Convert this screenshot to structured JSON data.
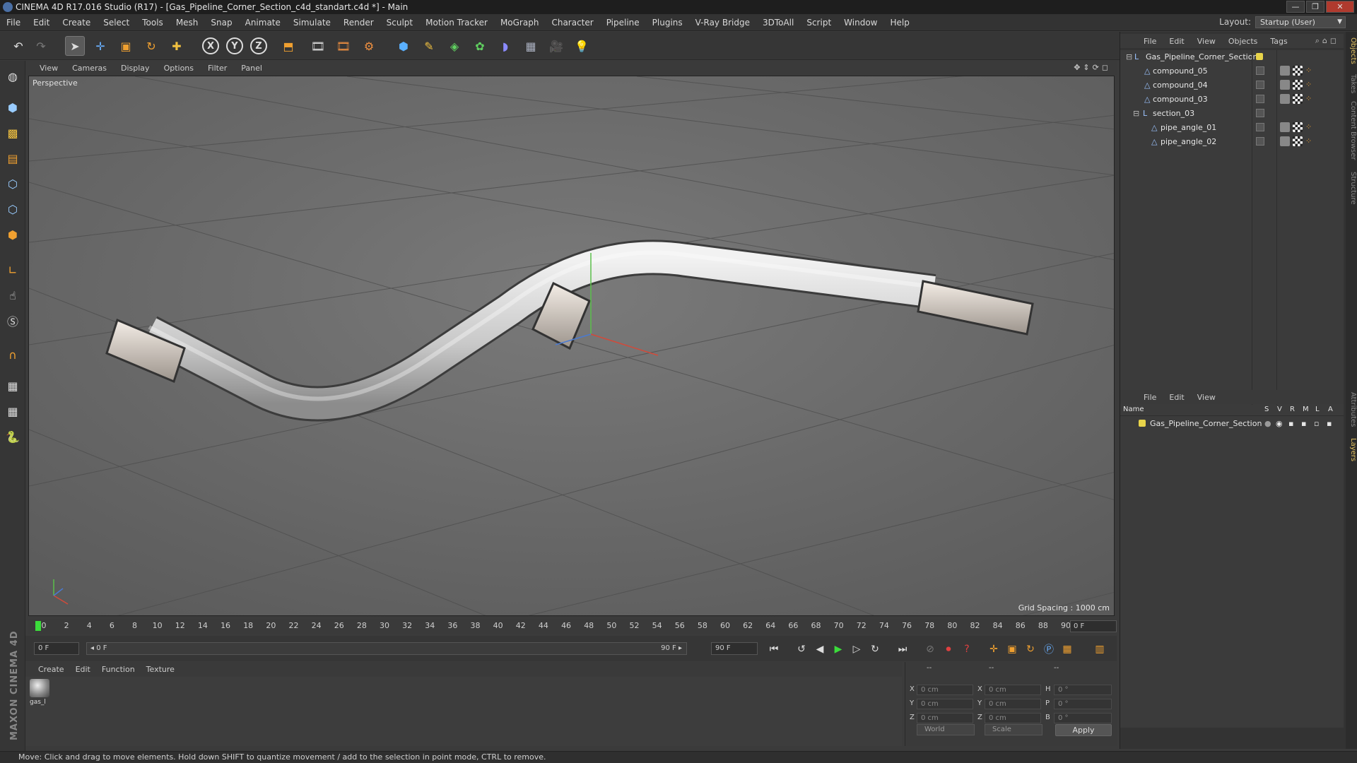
{
  "window": {
    "title": "CINEMA 4D R17.016 Studio (R17) - [Gas_Pipeline_Corner_Section_c4d_standart.c4d *] - Main",
    "buttons": [
      "—",
      "❐",
      "✕"
    ]
  },
  "menubar": {
    "items": [
      "File",
      "Edit",
      "Create",
      "Select",
      "Tools",
      "Mesh",
      "Snap",
      "Animate",
      "Simulate",
      "Render",
      "Sculpt",
      "Motion Tracker",
      "MoGraph",
      "Character",
      "Pipeline",
      "Plugins",
      "V-Ray Bridge",
      "3DToAll",
      "Script",
      "Window",
      "Help"
    ],
    "layout_label": "Layout:",
    "layout_value": "Startup (User)"
  },
  "toolbar": {
    "icons": [
      "undo-icon",
      "redo-icon",
      "select-arrow-icon",
      "move-icon",
      "scale-icon",
      "rotate-icon",
      "live-selection-icon",
      "x-axis-icon",
      "y-axis-icon",
      "z-axis-icon",
      "coordinate-system-icon",
      "render-view-icon",
      "render-picture-viewer-icon",
      "edit-render-settings-icon",
      "cube-icon",
      "pen-icon",
      "subdivision-icon",
      "cloner-icon",
      "deformer-icon",
      "floor-icon",
      "camera-icon",
      "light-icon"
    ],
    "axis_labels": [
      "X",
      "Y",
      "Z"
    ]
  },
  "left_tools": [
    "make-editable-icon",
    "model-mode-icon",
    "texture-mode-icon",
    "workplane-icon",
    "points-mode-icon",
    "edges-mode-icon",
    "polygons-mode-icon",
    "axis-mode-icon",
    "tweak-icon",
    "snap-s-icon",
    "magnet-icon",
    "grid-snap-icon",
    "grid-lock-icon",
    "python-icon"
  ],
  "viewport": {
    "menu": [
      "View",
      "Cameras",
      "Display",
      "Options",
      "Filter",
      "Panel"
    ],
    "label": "Perspective",
    "grid_spacing": "Grid Spacing : 1000 cm",
    "nav_icons": [
      "move-view-icon",
      "zoom-view-icon",
      "rotate-view-icon",
      "maximize-view-icon"
    ]
  },
  "timeline": {
    "ticks": [
      "0",
      "2",
      "4",
      "6",
      "8",
      "10",
      "12",
      "14",
      "16",
      "18",
      "20",
      "22",
      "24",
      "26",
      "28",
      "30",
      "32",
      "34",
      "36",
      "38",
      "40",
      "42",
      "44",
      "46",
      "48",
      "50",
      "52",
      "54",
      "56",
      "58",
      "60",
      "62",
      "64",
      "66",
      "68",
      "70",
      "72",
      "74",
      "76",
      "78",
      "80",
      "82",
      "84",
      "86",
      "88",
      "90"
    ],
    "current_frame": "0 F",
    "start_frame": "0 F",
    "range_start": "◂ 0 F",
    "range_end": "90 F ▸",
    "end_frame": "90 F"
  },
  "transport": {
    "icons": [
      "go-start-icon",
      "prev-key-icon",
      "play-back-icon",
      "play-icon",
      "next-frame-icon",
      "next-key-icon",
      "go-end-icon",
      "record-icon",
      "autokey-icon",
      "key-help-icon",
      "move-key-icon",
      "scale-key-icon",
      "rotate-key-icon",
      "param-key-icon",
      "pla-key-icon",
      "timeline-icon"
    ]
  },
  "material_manager": {
    "menu": [
      "Create",
      "Edit",
      "Function",
      "Texture"
    ],
    "material_name": "gas_l"
  },
  "coordinates": {
    "header": [
      "--",
      "--",
      "--"
    ],
    "rows": [
      {
        "axis": "X",
        "pos": "0 cm",
        "axis2": "X",
        "size": "0 cm",
        "rot_label": "H",
        "rot": "0 °"
      },
      {
        "axis": "Y",
        "pos": "0 cm",
        "axis2": "Y",
        "size": "0 cm",
        "rot_label": "P",
        "rot": "0 °"
      },
      {
        "axis": "Z",
        "pos": "0 cm",
        "axis2": "Z",
        "size": "0 cm",
        "rot_label": "B",
        "rot": "0 °"
      }
    ],
    "space": "World",
    "mode": "Scale",
    "apply": "Apply"
  },
  "status": "Move: Click and drag to move elements. Hold down SHIFT to quantize movement / add to the selection in point mode, CTRL to remove.",
  "object_manager": {
    "menu": [
      "File",
      "Edit",
      "View",
      "Objects",
      "Tags"
    ],
    "objects": [
      {
        "name": "Gas_Pipeline_Corner_Section",
        "depth": 0,
        "type": "null"
      },
      {
        "name": "compound_05",
        "depth": 1,
        "type": "mesh"
      },
      {
        "name": "compound_04",
        "depth": 1,
        "type": "mesh"
      },
      {
        "name": "compound_03",
        "depth": 1,
        "type": "mesh"
      },
      {
        "name": "section_03",
        "depth": 1,
        "type": "null"
      },
      {
        "name": "pipe_angle_01",
        "depth": 2,
        "type": "mesh"
      },
      {
        "name": "pipe_angle_02",
        "depth": 2,
        "type": "mesh"
      }
    ]
  },
  "layer_manager": {
    "menu": [
      "File",
      "Edit",
      "View"
    ],
    "columns": [
      "Name",
      "S",
      "V",
      "R",
      "M",
      "L",
      "A"
    ],
    "layers": [
      {
        "name": "Gas_Pipeline_Corner_Section",
        "color": "#e8d44a"
      }
    ]
  },
  "side_tabs": [
    "Objects",
    "Takes",
    "Content Browser",
    "Structure",
    "Attributes",
    "Layers"
  ],
  "brand": "MAXON CINEMA 4D"
}
